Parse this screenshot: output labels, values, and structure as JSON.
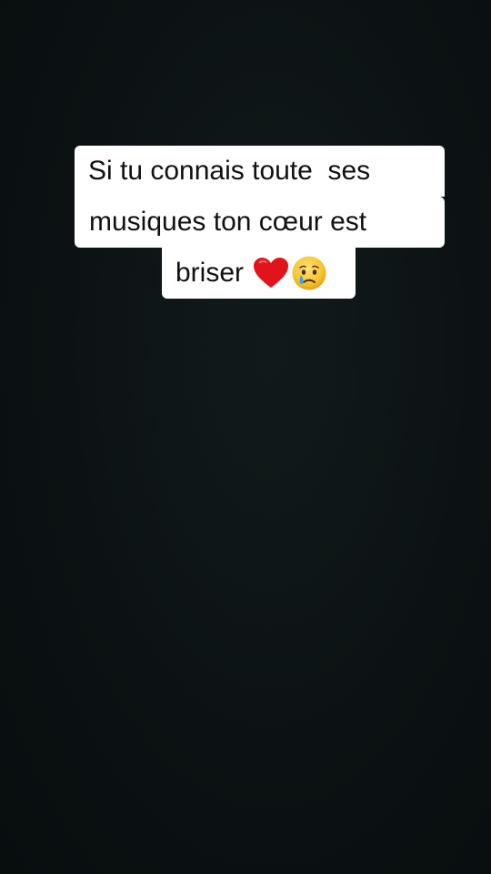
{
  "caption": {
    "line1": "Si tu connais toute  ses",
    "line2": "musiques ton cœur est",
    "line3": "briser"
  },
  "emojis": [
    {
      "icon": "red-heart-icon",
      "color": "#e0151b"
    },
    {
      "icon": "crying-face-icon",
      "color": "#f6c232"
    }
  ],
  "colors": {
    "background": "#0d1314",
    "caption_background": "#ffffff",
    "caption_text": "#111111"
  }
}
